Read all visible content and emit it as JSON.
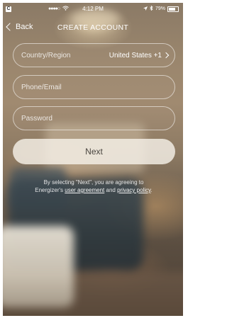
{
  "status_bar": {
    "app_badge": "C",
    "signal": "●●●●○",
    "time": "4:12 PM",
    "battery_percent": "79%",
    "battery_level": 0.79
  },
  "nav": {
    "back_label": "Back",
    "title": "CREATE ACCOUNT"
  },
  "form": {
    "country_label": "Country/Region",
    "country_value": "United States +1",
    "phone_placeholder": "Phone/Email",
    "password_placeholder": "Password",
    "next_label": "Next"
  },
  "agreement": {
    "line1": "By selecting \"Next\", you are agreeing to",
    "prefix": "Energizer's ",
    "user_agreement": "user agreement",
    "and": " and ",
    "privacy_policy": "privacy policy",
    "suffix": "."
  }
}
